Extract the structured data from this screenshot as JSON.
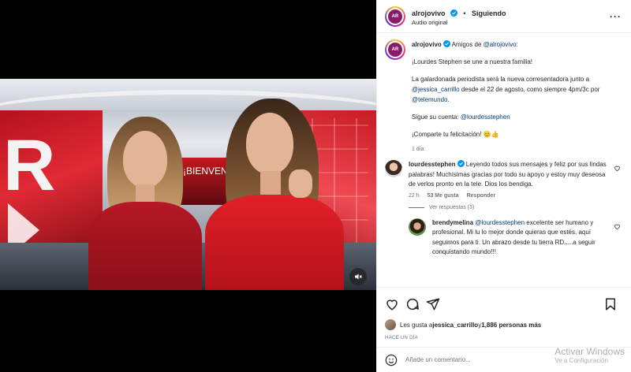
{
  "header": {
    "username": "alrojovivo",
    "separator": "•",
    "follow_label": "Siguiendo",
    "audio": "Audio original",
    "more": "···"
  },
  "caption": {
    "username": "alrojovivo",
    "intro_prefix": "Amigos de ",
    "intro_mention": "@alrojovivo",
    "intro_suffix": ":",
    "line1": "¡Lourdes Stephen se une a nuestra familia!",
    "p2_a": "La galardonada periodista será la nueva corresentadora junto a ",
    "p2_mention1": "@jessica_carrillo",
    "p2_b": " desde el 22 de agosto, como siempre 4pm/3c por ",
    "p2_mention2": "@telemundo",
    "p2_c": ".",
    "p3_a": "Sigue su cuenta: ",
    "p3_mention": "@lourdesstephen",
    "p4": "¡Comparte tu felicitación! 😊👍",
    "time": "1 día"
  },
  "comments": [
    {
      "username": "lourdesstephen",
      "text": " Leyendo todos sus mensajes y feliz por sus lindas palabras! Muchísimas gracias por todo su apoyo y estoy muy deseosa de verlos pronto en la tele. Dios los bendiga.",
      "time": "22 h",
      "likes": "53 Me gusta",
      "reply": "Responder"
    }
  ],
  "view_replies": "Ver respuestas (3)",
  "reply": {
    "username": "brendymelina",
    "mention": "@lourdesstephen",
    "text": " excelente ser humano y profesional. Mi lu lo mejor donde quieras que estés, aquí seguimos para ti. Un abrazo desde tu tierra RD.....a seguir conquistando mundo!!!"
  },
  "likes": {
    "prefix": "Les gusta a ",
    "user": "jessica_carrillo",
    "middle": " y ",
    "count": "1,886 personas más"
  },
  "post_date": "HACE UN DÍA",
  "comment_input": {
    "placeholder": "Añade un comentario..."
  },
  "video": {
    "screen_text": "¡BIENVENI"
  },
  "watermark": {
    "line1": "Activar Windows",
    "line2": "Ve a Configuración"
  },
  "colors": {
    "link": "#00376b",
    "verified": "#0095f6",
    "brand": "#8a1b6b"
  },
  "icons": [
    "heart-icon",
    "comment-icon",
    "share-icon",
    "bookmark-icon",
    "smile-icon",
    "mute-icon",
    "more-icon",
    "verified-icon"
  ]
}
